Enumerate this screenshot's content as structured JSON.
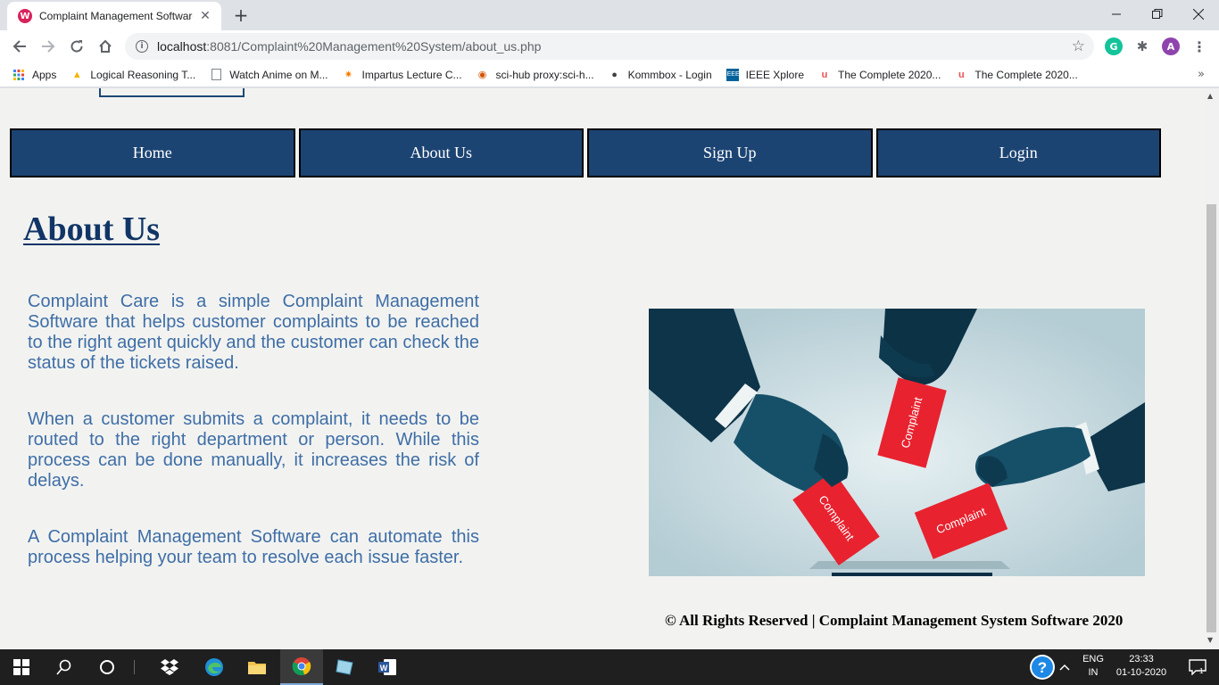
{
  "browser": {
    "tab_title": "Complaint Management Software",
    "tab_close": "✕",
    "new_tab": "+",
    "url_host": "localhost",
    "url_rest": ":8081/Complaint%20Management%20System/about_us.php",
    "profile_initial": "A",
    "extension_initial": "G",
    "bookmarks": [
      {
        "label": "Apps",
        "icon": "apps-grid-icon"
      },
      {
        "label": "Logical Reasoning T...",
        "icon": "triangle-icon"
      },
      {
        "label": "Watch Anime on M...",
        "icon": "page-icon"
      },
      {
        "label": "Impartus Lecture C...",
        "icon": "sparkle-icon"
      },
      {
        "label": "sci-hub proxy:sci-h...",
        "icon": "eye-icon"
      },
      {
        "label": "Kommbox - Login",
        "icon": "globe-icon"
      },
      {
        "label": "IEEE Xplore",
        "icon": "ieee-icon"
      },
      {
        "label": "The Complete 2020...",
        "icon": "udemy-icon"
      },
      {
        "label": "The Complete 2020...",
        "icon": "udemy-icon"
      }
    ],
    "bookmarks_more": "»"
  },
  "site": {
    "nav": [
      "Home",
      "About Us",
      "Sign Up",
      "Login"
    ],
    "title": "About Us",
    "paragraphs": [
      "Complaint Care is a simple Complaint Management Software that helps customer complaints to be reached to the right agent quickly and the customer can check the status of the tickets raised.",
      "When a customer submits a complaint, it needs to be routed to the right department or person. While this process can be done manually, it increases the risk of delays.",
      "A Complaint Management Software can automate this process helping your team to resolve each issue faster."
    ],
    "image_cards": [
      "Complaint",
      "Complaint",
      "Complaint"
    ],
    "footer": "© All Rights Reserved | Complaint Management System Software 2020"
  },
  "taskbar": {
    "lang_top": "ENG",
    "lang_bottom": "IN",
    "time": "23:33",
    "date": "01-10-2020"
  },
  "colors": {
    "nav_bg": "#1c4473",
    "title": "#113566",
    "text": "#3f6ea6",
    "card": "#e8222f"
  }
}
